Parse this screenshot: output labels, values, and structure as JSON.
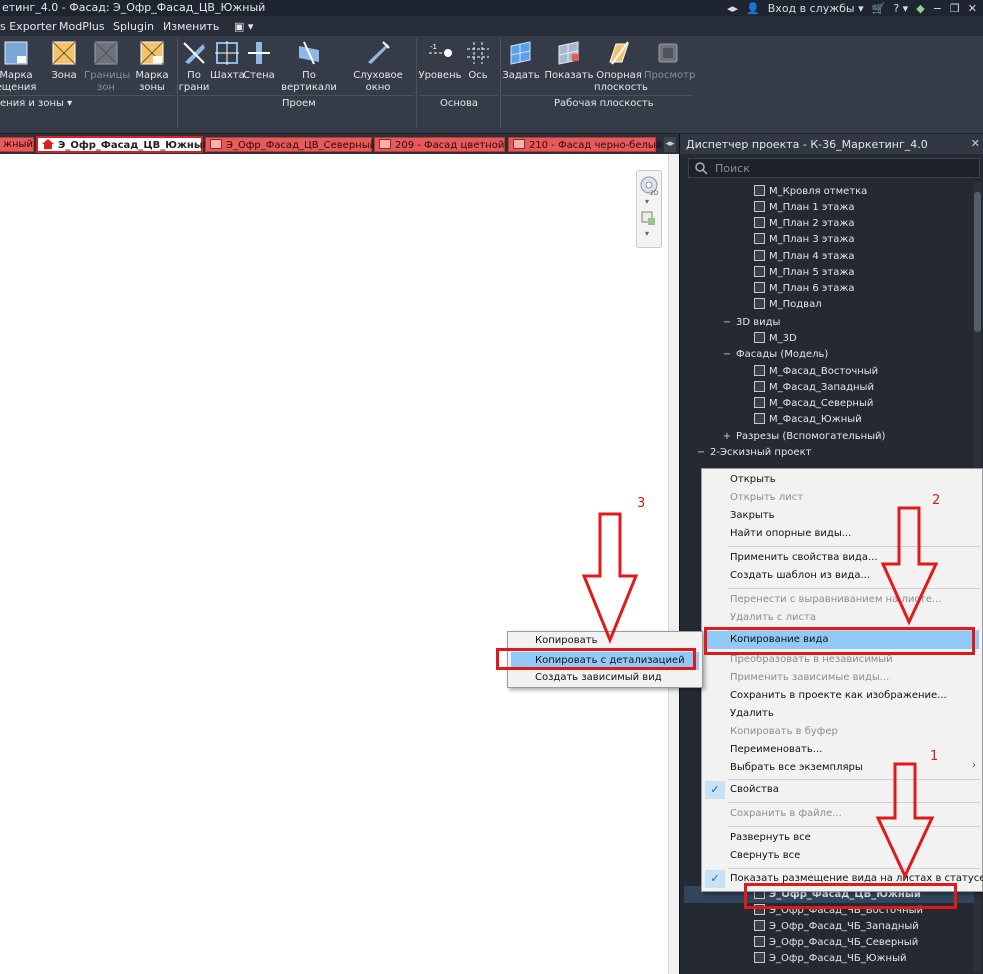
{
  "titlebar": {
    "title": "етинг_4.0 - Фасад: Э_Офр_Фасад_ЦВ_Южный",
    "signin": "Вход в службы",
    "help": "?"
  },
  "menubar": {
    "items": [
      "s Exporter",
      "ModPlus",
      "Splugin",
      "Изменить"
    ]
  },
  "ribbon": {
    "buttons": [
      {
        "label1": "Марка",
        "label2": "ещения",
        "icon": "room-tag-icon"
      },
      {
        "label1": "Зона",
        "label2": "",
        "icon": "area-icon"
      },
      {
        "label1": "Границы",
        "label2": "зон",
        "icon": "area-boundary-icon"
      },
      {
        "label1": "Марка",
        "label2": "зоны",
        "icon": "area-tag-icon"
      },
      {
        "label1": "По",
        "label2": "грани",
        "icon": "by-face-icon"
      },
      {
        "label1": "Шахта",
        "label2": "",
        "icon": "shaft-icon"
      },
      {
        "label1": "Стена",
        "label2": "",
        "icon": "wall-opening-icon"
      },
      {
        "label1": "По вертикали",
        "label2": "",
        "icon": "vertical-opening-icon"
      },
      {
        "label1": "Слуховое окно",
        "label2": "",
        "icon": "dormer-icon"
      },
      {
        "label1": "Уровень",
        "label2": "",
        "icon": "level-icon"
      },
      {
        "label1": "Ось",
        "label2": "",
        "icon": "grid-icon"
      },
      {
        "label1": "Задать",
        "label2": "",
        "icon": "set-plane-icon"
      },
      {
        "label1": "Показать",
        "label2": "",
        "icon": "show-plane-icon"
      },
      {
        "label1": "Опорная",
        "label2": "плоскость",
        "icon": "ref-plane-icon"
      },
      {
        "label1": "Просмотр",
        "label2": "",
        "icon": "viewer-icon"
      }
    ],
    "groups": [
      "ения и зоны",
      "Проем",
      "Основа",
      "Рабочая плоскость"
    ]
  },
  "tabs": [
    {
      "label": "жный"
    },
    {
      "label": "Э_Офр_Фасад_ЦВ_Южный"
    },
    {
      "label": "Э_Офр_Фасад_ЦВ_Северный"
    },
    {
      "label": "209 - Фасад цветной"
    },
    {
      "label": "210 - Фасад черно-белый"
    }
  ],
  "browser": {
    "title": "Диспетчер проекта - К-36_Маркетинг_4.0",
    "close": "✕",
    "search_placeholder": "Поиск",
    "tree": [
      {
        "label": "М_Кровля отметка"
      },
      {
        "label": "М_План 1 этажа"
      },
      {
        "label": "М_План 2 этажа"
      },
      {
        "label": "М_План 3 этажа"
      },
      {
        "label": "М_План 4 этажа"
      },
      {
        "label": "М_План 5 этажа"
      },
      {
        "label": "М_План 6 этажа"
      },
      {
        "label": "М_Подвал"
      },
      {
        "label": "3D виды",
        "toggle": "−"
      },
      {
        "label": "М_3D"
      },
      {
        "label": "Фасады (Модель)",
        "toggle": "−"
      },
      {
        "label": "М_Фасад_Восточный"
      },
      {
        "label": "М_Фасад_Западный"
      },
      {
        "label": "М_Фасад_Северный"
      },
      {
        "label": "М_Фасад_Южный"
      },
      {
        "label": "Разрезы (Вспомогательный)",
        "toggle": "+"
      },
      {
        "label": "2-Эскизный проект",
        "toggle": "−"
      },
      {
        "label": "Э_Офр_Фасад_ЦВ_Южный"
      },
      {
        "label": "Э_Офр_Фасад_ЧБ_Восточный"
      },
      {
        "label": "Э_Офр_Фасад_ЧБ_Западный"
      },
      {
        "label": "Э_Офр_Фасад_ЧБ_Северный"
      },
      {
        "label": "Э_Офр_Фасад_ЧБ_Южный"
      }
    ]
  },
  "context_menu": {
    "items": [
      {
        "label": "Открыть",
        "disabled": false
      },
      {
        "label": "Открыть лист",
        "disabled": true
      },
      {
        "label": "Закрыть",
        "disabled": false
      },
      {
        "label": "Найти опорные виды...",
        "disabled": false
      },
      {
        "label": "Применить свойства вида...",
        "disabled": false
      },
      {
        "label": "Создать шаблон из вида...",
        "disabled": false
      },
      {
        "label": "Перенести с выравниванием на листе...",
        "disabled": true
      },
      {
        "label": "Удалить с листа",
        "disabled": true
      },
      {
        "label": "Копирование вида",
        "disabled": false
      },
      {
        "label": "Преобразовать в независимый",
        "disabled": true
      },
      {
        "label": "Применить зависимые виды...",
        "disabled": true
      },
      {
        "label": "Сохранить в проекте как изображение...",
        "disabled": false
      },
      {
        "label": "Удалить",
        "disabled": false
      },
      {
        "label": "Копировать в буфер",
        "disabled": true
      },
      {
        "label": "Переименовать...",
        "disabled": false
      },
      {
        "label": "Выбрать все экземпляры",
        "disabled": false
      },
      {
        "label": "Свойства",
        "disabled": false
      },
      {
        "label": "Сохранить в файле...",
        "disabled": true
      },
      {
        "label": "Развернуть все",
        "disabled": false
      },
      {
        "label": "Свернуть все",
        "disabled": false
      },
      {
        "label": "Показать размещение вида на листах в статусе",
        "disabled": false
      }
    ]
  },
  "submenu": {
    "items": [
      {
        "label": "Копировать"
      },
      {
        "label": "Копировать с детализацией"
      },
      {
        "label": "Создать зависимый вид"
      }
    ]
  },
  "annotations": {
    "numbers": [
      "1",
      "2",
      "3"
    ],
    "color": "#e01a1a"
  }
}
